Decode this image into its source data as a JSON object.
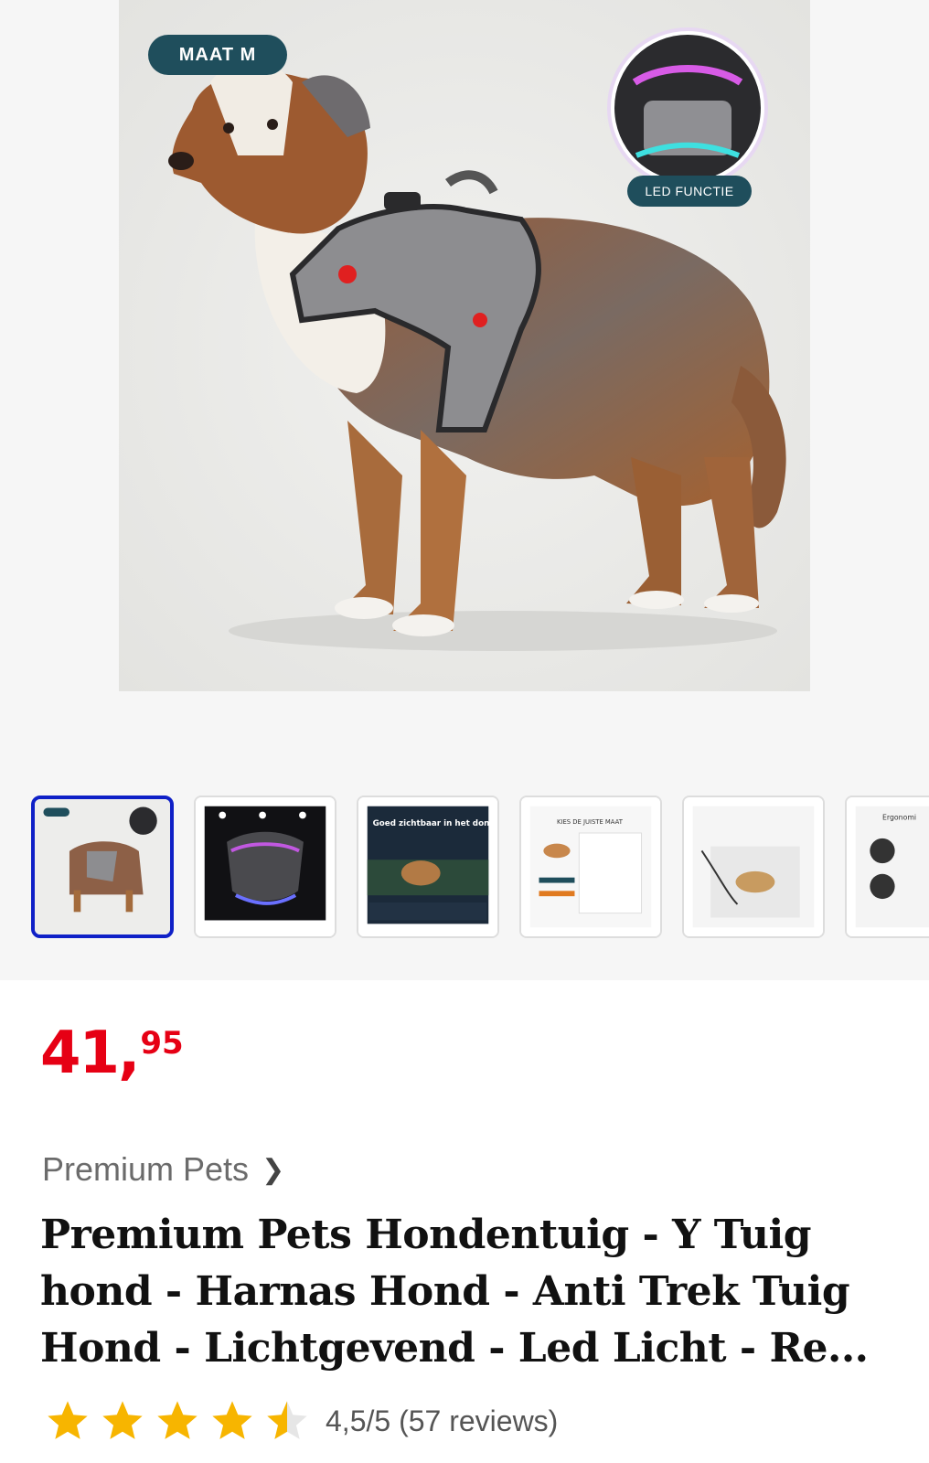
{
  "gallery": {
    "hero": {
      "badge_size": "MAAT M",
      "badge_led": "LED FUNCTIE",
      "image_alt": "Australian Shepherd wearing grey harness"
    },
    "thumbnails": [
      {
        "label": "Product image 1"
      },
      {
        "label": "Product image 2"
      },
      {
        "label": "Goed zichtbaar in het donker"
      },
      {
        "label": "KIES DE JUISTE MAAT"
      },
      {
        "label": "Product image 5"
      },
      {
        "label": "Ergonomi"
      }
    ]
  },
  "product": {
    "price": {
      "euros": "41",
      "separator": ",",
      "cents": "95"
    },
    "brand": "Premium Pets",
    "title": "Premium Pets Hondentuig - Y Tuig hond - Harnas Hond - Anti Trek Tuig Hond - Lichtgevend - Led Licht - Re...",
    "rating": {
      "value": 4.5,
      "max": 5,
      "text": "4,5/5 (57 reviews)"
    }
  },
  "colors": {
    "price": "#e60014",
    "active_thumb_border": "#0f20c7",
    "badge": "#1f4e5c",
    "star": "#f7b500"
  }
}
